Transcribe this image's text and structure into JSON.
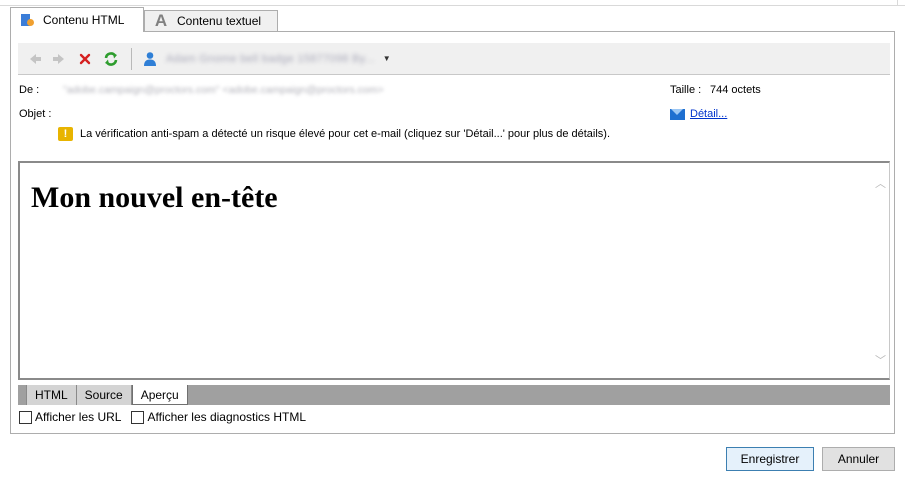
{
  "tabs": [
    {
      "label": "Contenu HTML",
      "icon": "html-content-icon"
    },
    {
      "label": "Contenu textuel",
      "icon": "text-content-icon"
    }
  ],
  "toolbar": {
    "back_icon": "arrow-left-icon",
    "forward_icon": "arrow-right-icon",
    "delete_icon": "delete-x-icon",
    "refresh_icon": "refresh-icon",
    "recipient_icon": "person-icon",
    "recipient_text": "Adam Gnome bell badge 15877098 By..."
  },
  "header": {
    "from_label": "De :",
    "from_value": "\"adobe.campaign@proctors.com\" <adobe.campaign@proctors.com>",
    "subject_label": "Objet :",
    "size_label": "Taille :",
    "size_value": "744 octets",
    "detail_link": "Détail...",
    "warning_text": "La vérification anti-spam a détecté un risque élevé pour cet e-mail (cliquez sur 'Détail...' pour plus de détails)."
  },
  "preview": {
    "heading": "Mon nouvel en-tête"
  },
  "view_tabs": [
    "HTML",
    "Source",
    "Aperçu"
  ],
  "options": {
    "show_urls": "Afficher les URL",
    "show_diagnostics": "Afficher les diagnostics HTML"
  },
  "buttons": {
    "save": "Enregistrer",
    "cancel": "Annuler"
  },
  "colors": {
    "accent": "#3c7fb1",
    "warning": "#e8b400",
    "link": "#0033cc"
  }
}
